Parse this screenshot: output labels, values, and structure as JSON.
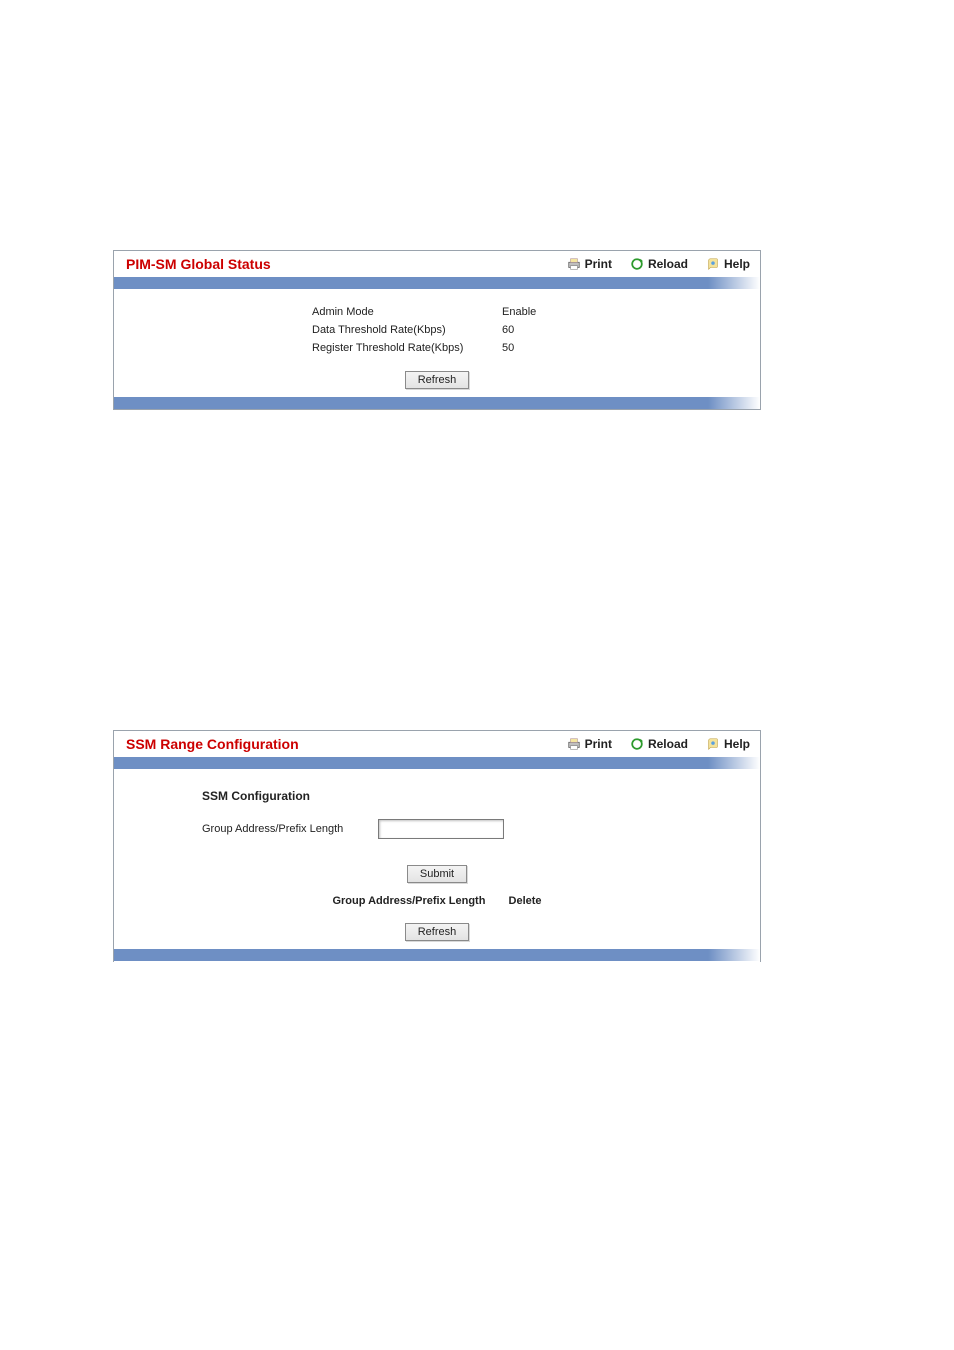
{
  "toolbar": {
    "print": "Print",
    "reload": "Reload",
    "help": "Help"
  },
  "buttons": {
    "refresh": "Refresh",
    "submit": "Submit"
  },
  "panel1": {
    "title": "PIM-SM Global Status",
    "rows": [
      {
        "label": "Admin Mode",
        "value": "Enable"
      },
      {
        "label": "Data Threshold Rate(Kbps)",
        "value": "60"
      },
      {
        "label": "Register Threshold Rate(Kbps)",
        "value": "50"
      }
    ]
  },
  "panel2": {
    "title": "SSM Range Configuration",
    "section_heading": "SSM Configuration",
    "field_label": "Group Address/Prefix Length",
    "field_value": "",
    "col1": "Group Address/Prefix Length",
    "col2": "Delete"
  }
}
